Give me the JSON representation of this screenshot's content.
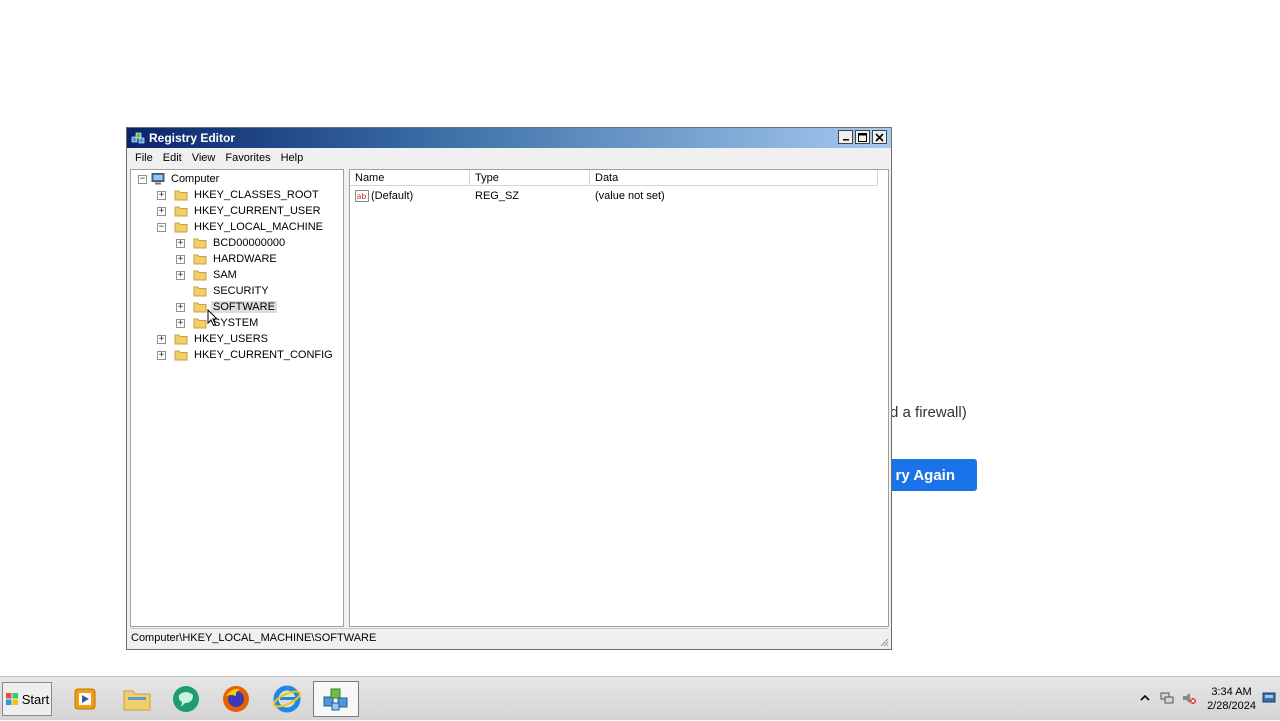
{
  "background_page": {
    "message_fragment": "hind a firewall)",
    "button_fragment": "ry Again",
    "button_color": "#1a73e8"
  },
  "window": {
    "title": "Registry Editor",
    "controls": {
      "minimize": "minimize-icon",
      "maximize": "maximize-icon",
      "close": "close-icon"
    },
    "menu": [
      "File",
      "Edit",
      "View",
      "Favorites",
      "Help"
    ]
  },
  "tree": {
    "root": "Computer",
    "items": [
      {
        "label": "HKEY_CLASSES_ROOT",
        "expander": "+"
      },
      {
        "label": "HKEY_CURRENT_USER",
        "expander": "+"
      },
      {
        "label": "HKEY_LOCAL_MACHINE",
        "expander": "−"
      },
      {
        "label": "BCD00000000",
        "expander": "+"
      },
      {
        "label": "HARDWARE",
        "expander": "+"
      },
      {
        "label": "SAM",
        "expander": "+"
      },
      {
        "label": "SECURITY",
        "expander": ""
      },
      {
        "label": "SOFTWARE",
        "expander": "+",
        "selected": true
      },
      {
        "label": "SYSTEM",
        "expander": "+"
      },
      {
        "label": "HKEY_USERS",
        "expander": "+"
      },
      {
        "label": "HKEY_CURRENT_CONFIG",
        "expander": "+"
      }
    ]
  },
  "list": {
    "columns": [
      "Name",
      "Type",
      "Data"
    ],
    "rows": [
      {
        "name": "(Default)",
        "type": "REG_SZ",
        "data": "(value not set)",
        "icon": "string-value-icon"
      }
    ]
  },
  "statusbar": {
    "path": "Computer\\HKEY_LOCAL_MACHINE\\SOFTWARE"
  },
  "taskbar": {
    "start_label": "Start",
    "apps": [
      "media-player-icon",
      "file-explorer-icon",
      "chat-app-icon",
      "firefox-icon",
      "internet-explorer-icon",
      "registry-editor-icon"
    ],
    "tray_icons": [
      "show-hidden-icons",
      "network-icon",
      "volume-muted-icon",
      "action-center-icon"
    ],
    "time": "3:34 AM",
    "date": "2/28/2024"
  }
}
